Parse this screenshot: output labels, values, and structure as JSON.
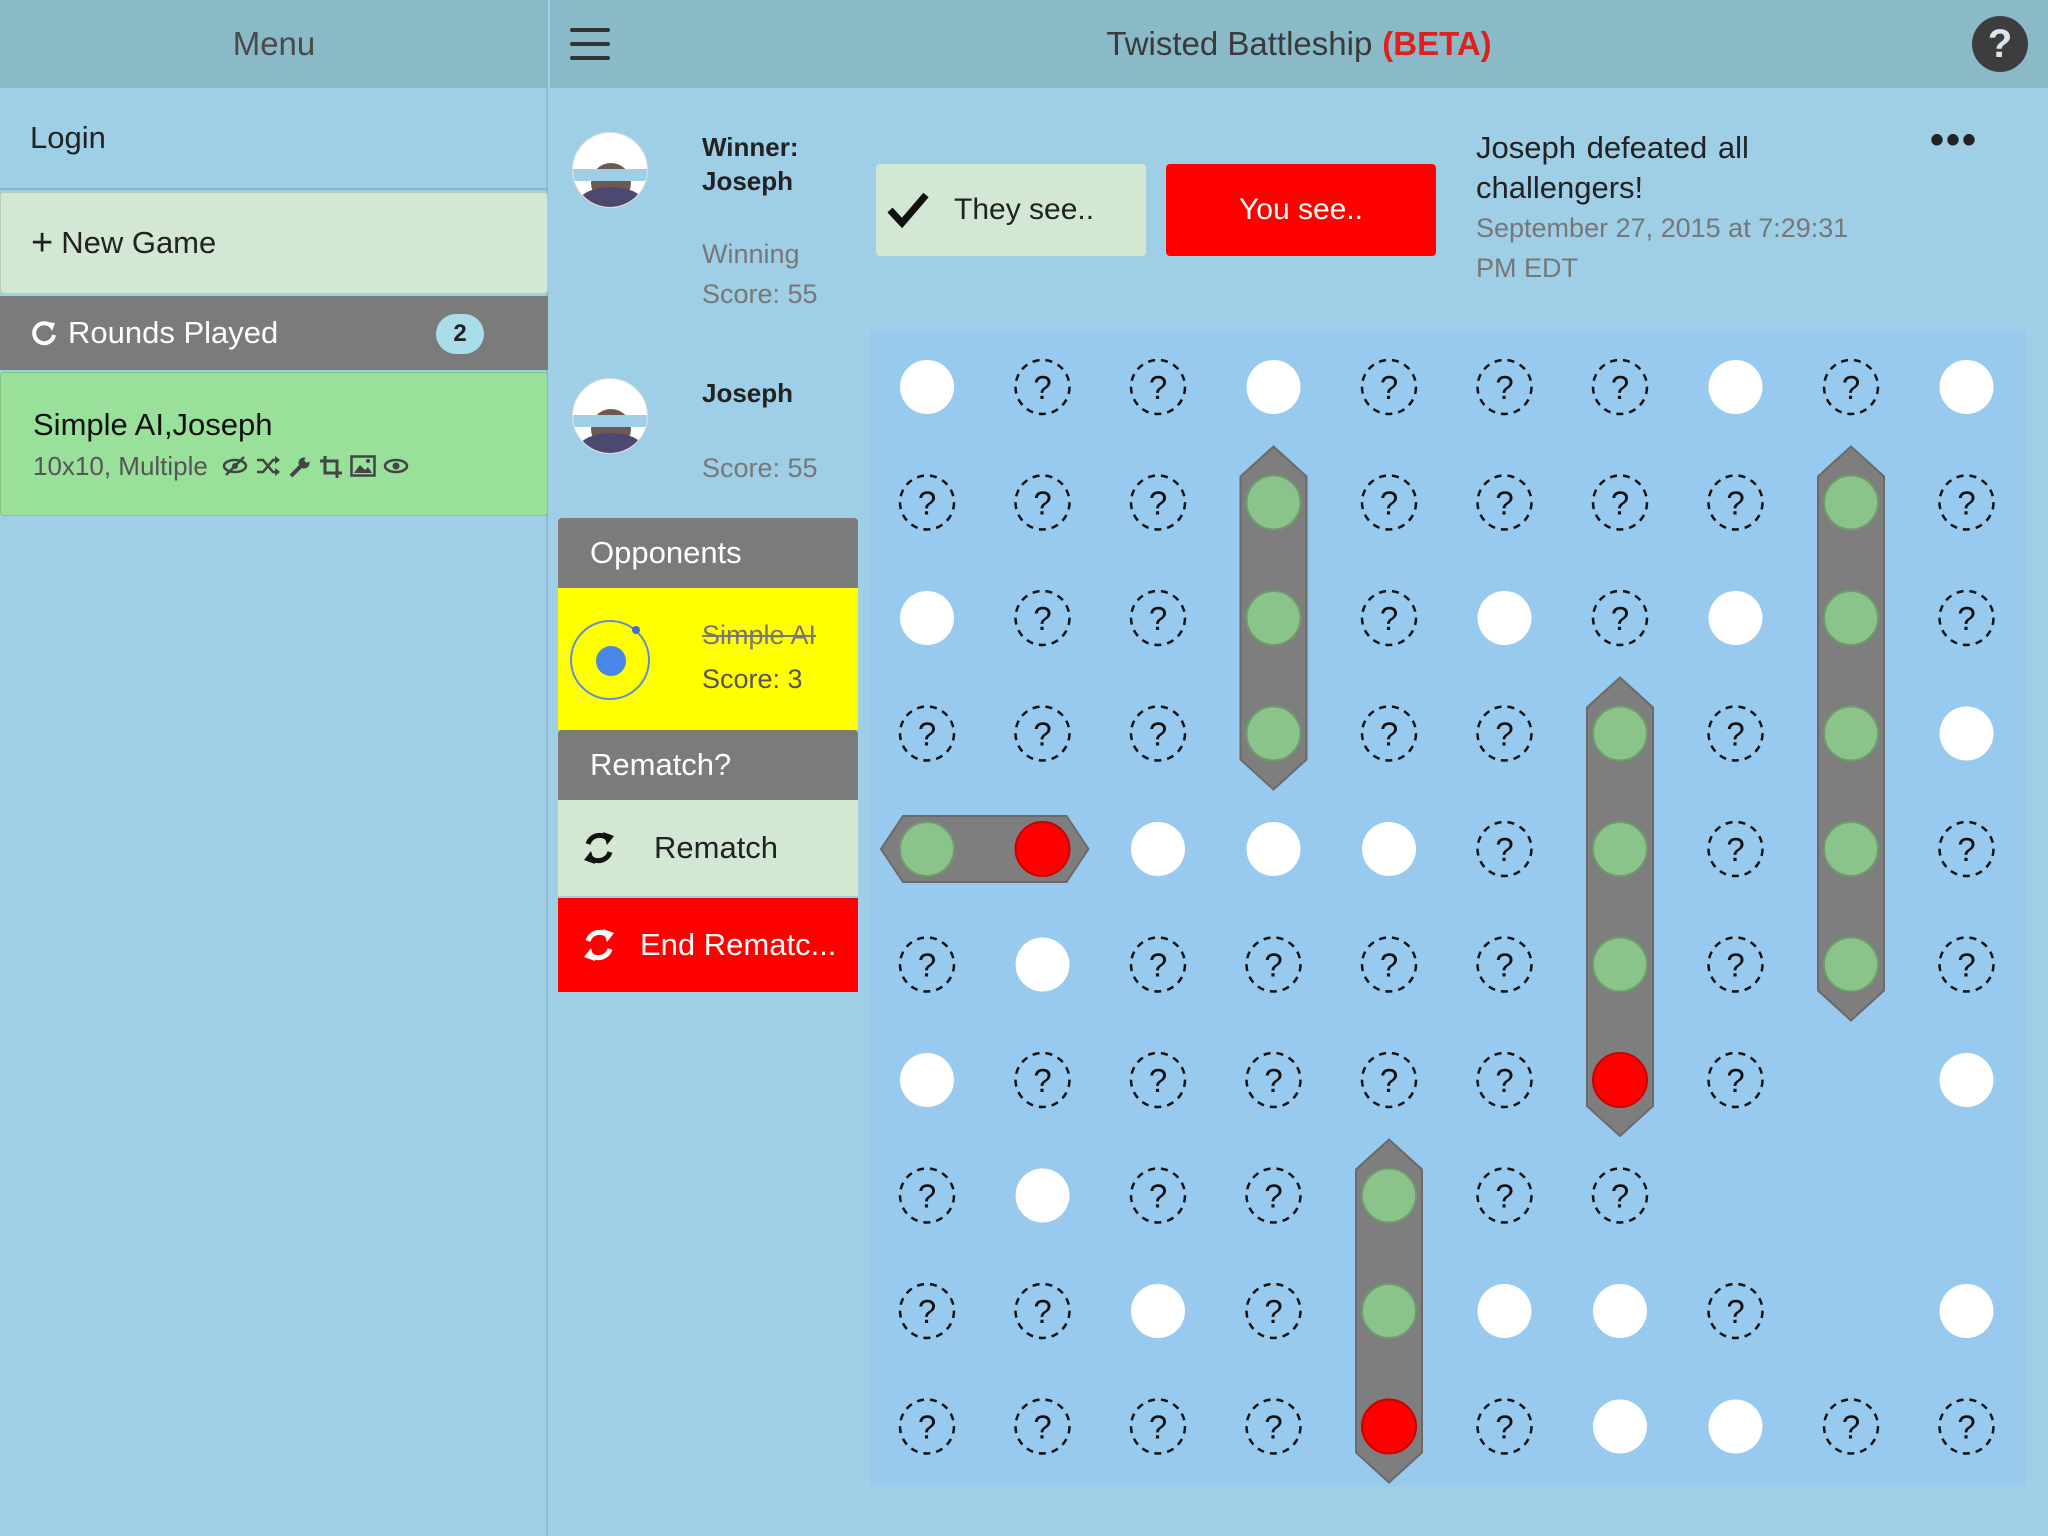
{
  "sidebar": {
    "title": "Menu",
    "login": "Login",
    "new_game": "New Game",
    "rounds_header": "Rounds Played",
    "rounds_count": "2",
    "round_item": {
      "title": "Simple AI,Joseph",
      "subtitle": "10x10, Multiple",
      "icons": [
        "eye-slash-icon",
        "shuffle-icon",
        "wrench-icon",
        "crop-icon",
        "image-icon",
        "eye-icon"
      ]
    }
  },
  "topbar": {
    "title": "Twisted Battleship",
    "beta": "(BETA)",
    "help": "?"
  },
  "players": {
    "winner_label": "Winner:",
    "winner_name": "Joseph",
    "winning_score": "Winning Score: 55",
    "me_name": "Joseph",
    "me_score": "Score: 55"
  },
  "opponents": {
    "header": "Opponents",
    "name": "Simple AI",
    "score": "Score: 3"
  },
  "rematch": {
    "header": "Rematch?",
    "rematch_label": "Rematch",
    "end_rematch_label": "End Rematc..."
  },
  "view_toggle": {
    "they_see": "They see..",
    "you_see": "You see.."
  },
  "status": {
    "message": "Joseph defeated all challengers!",
    "time": "September 27, 2015 at 7:29:31 PM EDT",
    "more": "•••"
  },
  "board": {
    "size": 10,
    "legend": {
      "W": "miss",
      "?": "unknown",
      "G": "ship-hit",
      "R": "ship-sunk-hit",
      ".": "ship-empty"
    },
    "rows": [
      [
        "W",
        "?",
        "?",
        "W",
        "?",
        "?",
        "?",
        "W",
        "?",
        "W"
      ],
      [
        "?",
        "?",
        "?",
        "G",
        "?",
        "?",
        "?",
        "?",
        "G",
        "?"
      ],
      [
        "W",
        "?",
        "?",
        "G",
        "?",
        "W",
        "?",
        "W",
        "G",
        "?"
      ],
      [
        "?",
        "?",
        "?",
        "G",
        "?",
        "?",
        "G",
        "?",
        "G",
        "W"
      ],
      [
        "G",
        "R",
        "W",
        "W",
        "W",
        "?",
        "G",
        "?",
        "G",
        "?"
      ],
      [
        "?",
        "W",
        "?",
        "?",
        "?",
        "?",
        "G",
        "?",
        "G",
        "?"
      ],
      [
        "W",
        "?",
        "?",
        "?",
        "?",
        "?",
        "R",
        "?",
        ".",
        "W"
      ],
      [
        "?",
        "W",
        "?",
        "?",
        "G",
        "?",
        "?",
        ".",
        ".",
        "."
      ],
      [
        "?",
        "?",
        "W",
        "?",
        "G",
        "W",
        "W",
        "?",
        ".",
        "W"
      ],
      [
        "?",
        "?",
        "?",
        "?",
        "R",
        "?",
        "W",
        "W",
        "?",
        "?"
      ]
    ],
    "ships": [
      {
        "orientation": "horizontal",
        "row": 4,
        "col": 0,
        "length": 2
      },
      {
        "orientation": "vertical",
        "row": 1,
        "col": 3,
        "length": 3
      },
      {
        "orientation": "vertical",
        "row": 3,
        "col": 6,
        "length": 4
      },
      {
        "orientation": "vertical",
        "row": 1,
        "col": 8,
        "length": 5
      },
      {
        "orientation": "vertical",
        "row": 7,
        "col": 4,
        "length": 3
      }
    ]
  }
}
